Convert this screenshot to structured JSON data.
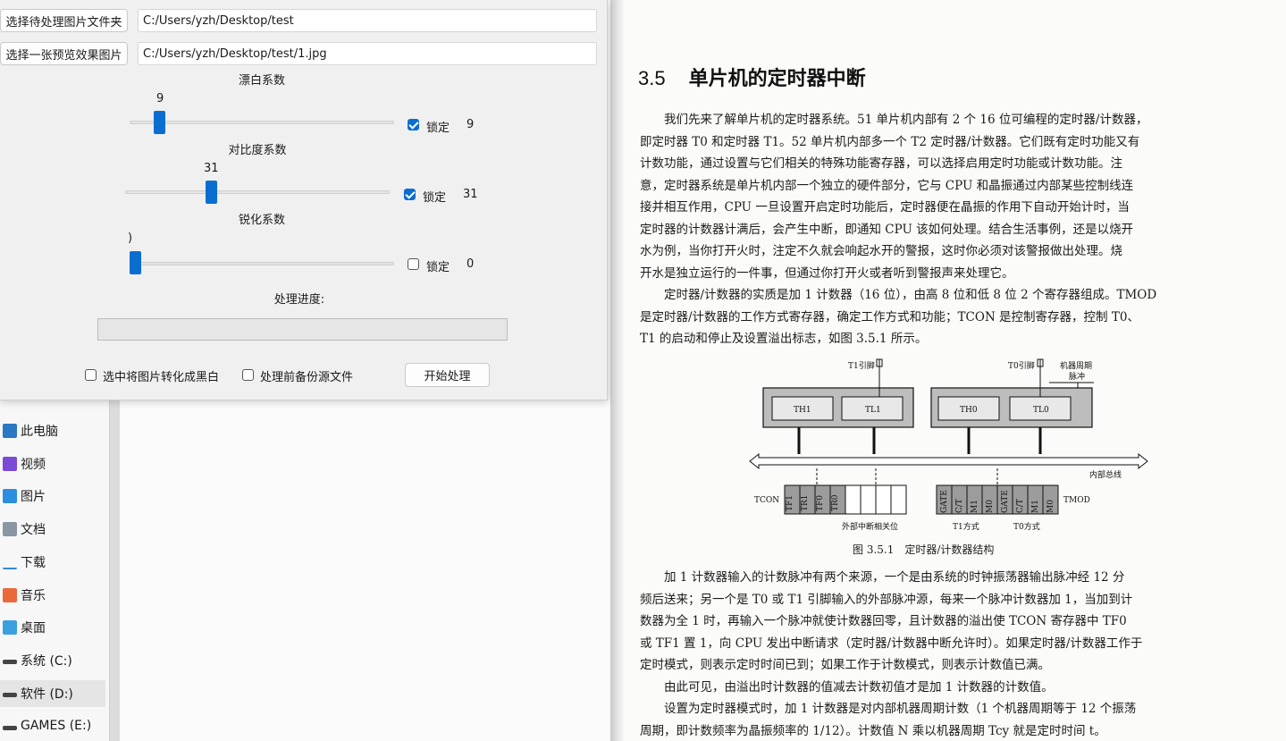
{
  "app": {
    "select_folder_button": "选择待处理图片文件夹",
    "folder_path": "C:/Users/yzh/Desktop/test",
    "select_preview_button": "选择一张预览效果图片",
    "preview_path": "C:/Users/yzh/Desktop/test/1.jpg",
    "sliders": [
      {
        "label": "漂白系数",
        "value_text": "9",
        "value": 9,
        "locked": true,
        "lock_label": "锁定",
        "lock_value": "9"
      },
      {
        "label": "对比度系数",
        "value_text": "31",
        "value": 31,
        "locked": true,
        "lock_label": "锁定",
        "lock_value": "31"
      },
      {
        "label": "锐化系数",
        "value_text": ")",
        "value": 0,
        "locked": false,
        "lock_label": "锁定",
        "lock_value": "0"
      }
    ],
    "progress_label": "处理进度:",
    "progress": 0,
    "grayscale_checkbox": "选中将图片转化成黑白",
    "backup_checkbox": "处理前备份源文件",
    "start_button": "开始处理",
    "accent_color": "#0a6ed1"
  },
  "explorer": {
    "nav_items": [
      {
        "label": "此电脑",
        "icon": "computer-icon"
      },
      {
        "label": "视频",
        "icon": "video-icon"
      },
      {
        "label": "图片",
        "icon": "pictures-icon"
      },
      {
        "label": "文档",
        "icon": "documents-icon"
      },
      {
        "label": "下载",
        "icon": "download-icon"
      },
      {
        "label": "音乐",
        "icon": "music-icon"
      },
      {
        "label": "桌面",
        "icon": "desktop-icon"
      },
      {
        "label": "系统 (C:)",
        "icon": "drive-icon"
      },
      {
        "label": "软件 (D:)",
        "icon": "drive-icon",
        "selected": true
      },
      {
        "label": "GAMES (E:)",
        "icon": "drive-icon"
      }
    ]
  },
  "document": {
    "section_number": "3.5",
    "section_title": "单片机的定时器中断",
    "para1_lines": [
      "我们先来了解单片机的定时器系统。51 单片机内部有 2 个 16 位可编程的定时器/计数器，",
      "即定时器 T0 和定时器 T1。52 单片机内部多一个 T2 定时器/计数器。它们既有定时功能又有",
      "计数功能，通过设置与它们相关的特殊功能寄存器，可以选择启用定时功能或计数功能。注",
      "意，定时器系统是单片机内部一个独立的硬件部分，它与 CPU 和晶振通过内部某些控制线连",
      "接并相互作用，CPU 一旦设置开启定时功能后，定时器便在晶振的作用下自动开始计时，当",
      "定时器的计数器计满后，会产生中断，即通知 CPU 该如何处理。结合生活事例，还是以烧开",
      "水为例，当你打开火时，注定不久就会响起水开的警报，这时你必须对该警报做出处理。烧",
      "开水是独立运行的一件事，但通过你打开火或者听到警报声来处理它。"
    ],
    "para2_lines": [
      "定时器/计数器的实质是加 1 计数器（16 位），由高 8 位和低 8 位 2 个寄存器组成。TMOD",
      "是定时器/计数器的工作方式寄存器，确定工作方式和功能；TCON 是控制寄存器，控制 T0、",
      "T1 的启动和停止及设置溢出标志，如图 3.5.1 所示。"
    ],
    "figure": {
      "t1_pin": "T1引脚",
      "t0_pin": "T0引脚",
      "machine_cycle": "机器周期",
      "pulse": "脉冲",
      "th1": "TH1",
      "tl1": "TL1",
      "th0": "TH0",
      "tl0": "TL0",
      "bus": "内部总线",
      "tcon": "TCON",
      "tmod": "TMOD",
      "tcon_bits": [
        "TF1",
        "TR1",
        "TF0",
        "TR0"
      ],
      "tmod_bits": [
        "GATE",
        "C/T",
        "M1",
        "M0",
        "GATE",
        "C/T",
        "M1",
        "M0"
      ],
      "ext_int": "外部中断相关位",
      "t1_mode": "T1方式",
      "t0_mode": "T0方式",
      "caption": "图 3.5.1　定时器/计数器结构"
    },
    "para3_lines": [
      "加 1 计数器输入的计数脉冲有两个来源，一个是由系统的时钟振荡器输出脉冲经 12 分",
      "频后送来；另一个是 T0 或 T1 引脚输入的外部脉冲源，每来一个脉冲计数器加 1，当加到计",
      "数器为全 1 时，再输入一个脉冲就使计数器回零，且计数器的溢出使 TCON 寄存器中 TF0",
      "或 TF1 置 1，向 CPU 发出中断请求（定时器/计数器中断允许时）。如果定时器/计数器工作于",
      "定时模式，则表示定时时间已到；如果工作于计数模式，则表示计数值已满。",
      "由此可见，由溢出时计数器的值减去计数初值才是加 1 计数器的计数值。",
      "设置为定时器模式时，加 1 计数器是对内部机器周期计数（1 个机器周期等于 12 个振荡",
      "周期，即计数频率为晶振频率的 1/12）。计数值 N 乘以机器周期 Tcy 就是定时时间 t。"
    ]
  }
}
